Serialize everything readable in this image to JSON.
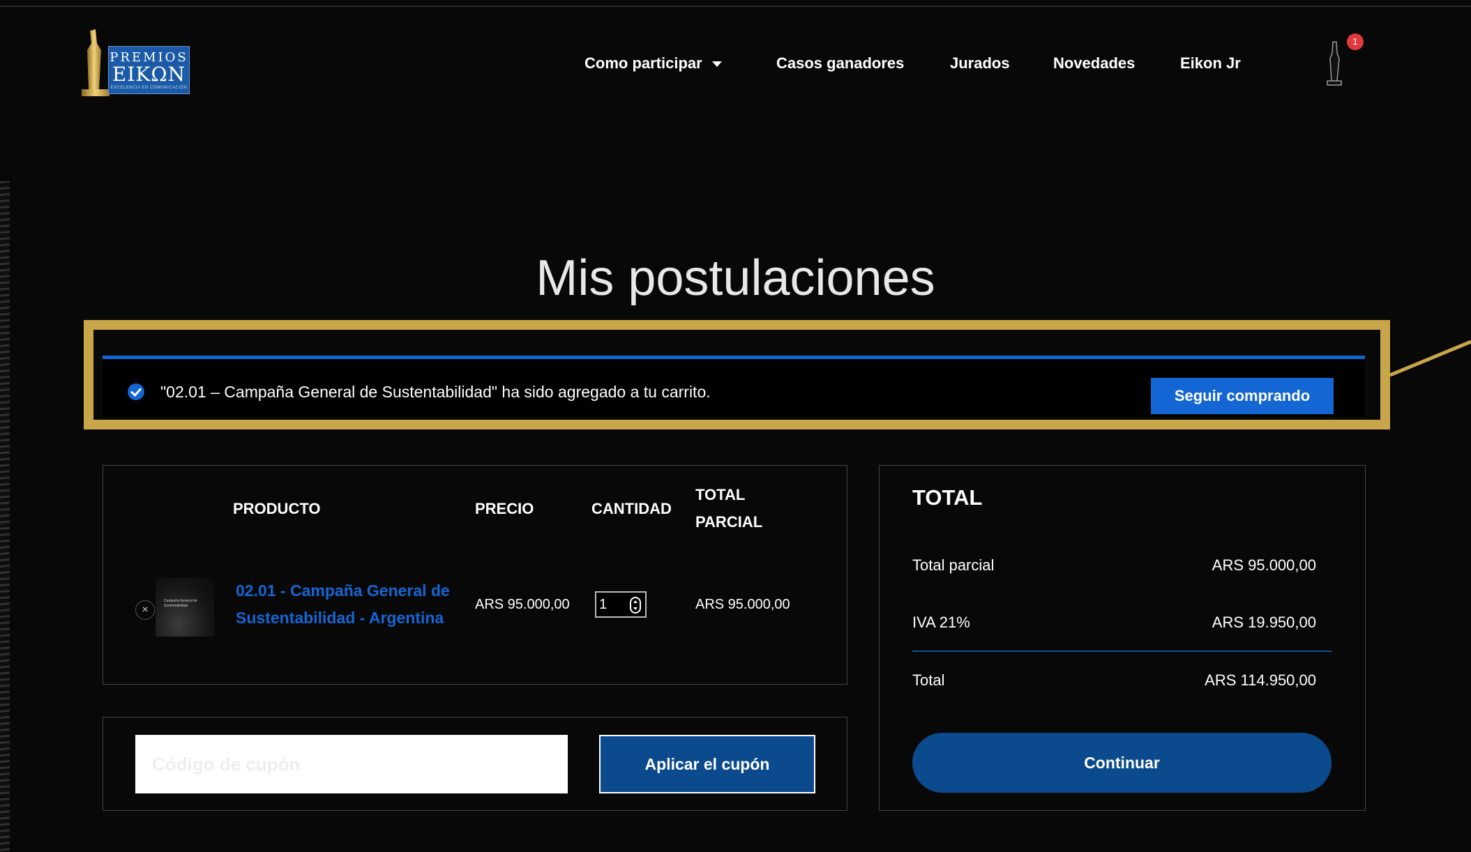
{
  "brand": {
    "line1": "PREMIOS",
    "line2": "EIKΩN",
    "tagline": "EXCELENCIA EN COMUNICACIÓN"
  },
  "nav": {
    "items": [
      {
        "label": "Como participar",
        "has_dropdown": true
      },
      {
        "label": "Casos ganadores"
      },
      {
        "label": "Jurados"
      },
      {
        "label": "Novedades"
      },
      {
        "label": "Eikon Jr"
      }
    ],
    "cart_count": "1"
  },
  "page": {
    "title": "Mis postulaciones"
  },
  "notice": {
    "message": "\"02.01 – Campaña General de Sustentabilidad\" ha sido agregado a tu carrito.",
    "button_label": "Seguir comprando"
  },
  "cart": {
    "headers": {
      "product": "PRODUCTO",
      "price": "PRECIO",
      "quantity": "CANTIDAD",
      "subtotal_line1": "TOTAL",
      "subtotal_line2": "PARCIAL"
    },
    "items": [
      {
        "name": "02.01 - Campaña General de Sustentabilidad - Argentina",
        "thumb_text": "Campaña General de Sustentabilidad",
        "price": "ARS 95.000,00",
        "quantity": "1",
        "subtotal": "ARS 95.000,00"
      }
    ]
  },
  "coupon": {
    "placeholder": "Código de cupón",
    "apply_label": "Aplicar el cupón"
  },
  "totals": {
    "title": "TOTAL",
    "rows": [
      {
        "label": "Total parcial",
        "value": "ARS 95.000,00"
      },
      {
        "label": "IVA 21%",
        "value": "ARS 19.950,00"
      },
      {
        "label": "Total",
        "value": "ARS 114.950,00"
      }
    ],
    "checkout_label": "Continuar"
  },
  "colors": {
    "accent_blue": "#1466d4",
    "dark_blue": "#0b4a8c",
    "highlight_gold": "#c9a64a",
    "badge_red": "#e03a3e"
  }
}
